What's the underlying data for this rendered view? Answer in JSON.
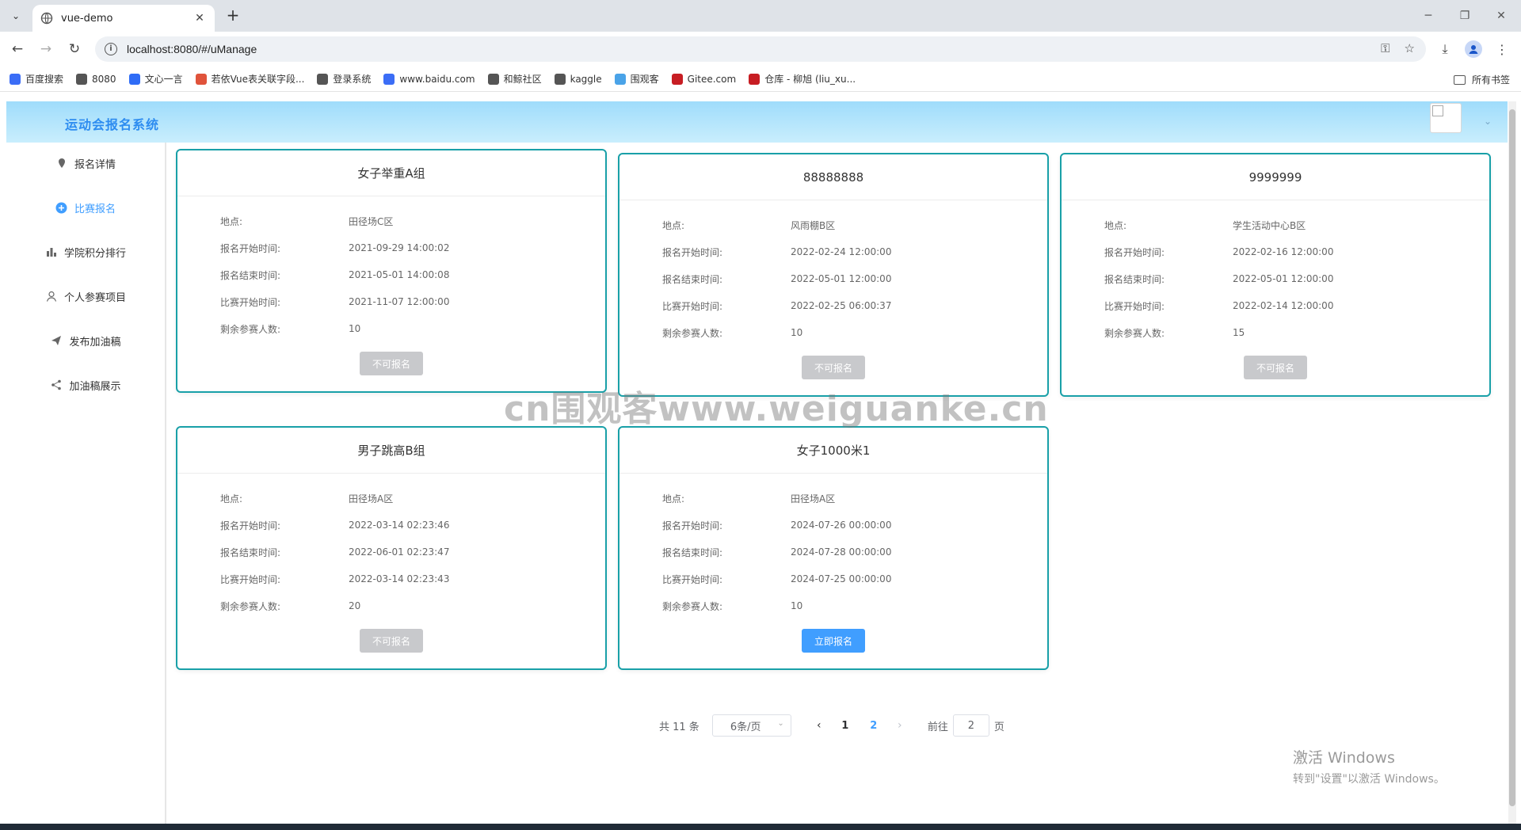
{
  "browser": {
    "tab_title": "vue-demo",
    "url": "localhost:8080/#/uManage",
    "bookmarks": [
      {
        "label": "百度搜索",
        "color": "#3b6df6"
      },
      {
        "label": "8080",
        "color": "#555555"
      },
      {
        "label": "文心一言",
        "color": "#2f6cf6"
      },
      {
        "label": "若依Vue表关联字段...",
        "color": "#e0533b"
      },
      {
        "label": "登录系统",
        "color": "#555555"
      },
      {
        "label": "www.baidu.com",
        "color": "#3b6df6"
      },
      {
        "label": "和鲸社区",
        "color": "#555555"
      },
      {
        "label": "kaggle",
        "color": "#555555"
      },
      {
        "label": "围观客",
        "color": "#4aa3e8"
      },
      {
        "label": "Gitee.com",
        "color": "#c71d23"
      },
      {
        "label": "仓库 - 柳旭 (liu_xu...",
        "color": "#c71d23"
      }
    ],
    "all_bookmarks": "所有书签"
  },
  "app": {
    "title": "运动会报名系统",
    "menu": [
      {
        "label": "报名详情",
        "icon": "location-icon"
      },
      {
        "label": "比赛报名",
        "icon": "plus-circle-icon",
        "active": true
      },
      {
        "label": "学院积分排行",
        "icon": "bar-chart-icon"
      },
      {
        "label": "个人参赛项目",
        "icon": "user-icon"
      },
      {
        "label": "发布加油稿",
        "icon": "send-icon"
      },
      {
        "label": "加油稿展示",
        "icon": "share-icon"
      }
    ],
    "field_labels": {
      "location": "地点:",
      "signup_start": "报名开始时间:",
      "signup_end": "报名结束时间:",
      "match_start": "比赛开始时间:",
      "remaining": "剩余参赛人数:"
    },
    "cards": [
      {
        "name": "女子举重A组",
        "location": "田径场C区",
        "signup_start": "2021-09-29 14:00:02",
        "signup_end": "2021-05-01 14:00:08",
        "match_start": "2021-11-07 12:00:00",
        "remaining": "10",
        "button": "不可报名",
        "enabled": false
      },
      {
        "name": "88888888",
        "location": "风雨棚B区",
        "signup_start": "2022-02-24 12:00:00",
        "signup_end": "2022-05-01 12:00:00",
        "match_start": "2022-02-25 06:00:37",
        "remaining": "10",
        "button": "不可报名",
        "enabled": false
      },
      {
        "name": "9999999",
        "location": "学生活动中心B区",
        "signup_start": "2022-02-16 12:00:00",
        "signup_end": "2022-05-01 12:00:00",
        "match_start": "2022-02-14 12:00:00",
        "remaining": "15",
        "button": "不可报名",
        "enabled": false
      },
      {
        "name": "男子跳高B组",
        "location": "田径场A区",
        "signup_start": "2022-03-14 02:23:46",
        "signup_end": "2022-06-01 02:23:47",
        "match_start": "2022-03-14 02:23:43",
        "remaining": "20",
        "button": "不可报名",
        "enabled": false
      },
      {
        "name": "女子1000米1",
        "location": "田径场A区",
        "signup_start": "2024-07-26 00:00:00",
        "signup_end": "2024-07-28 00:00:00",
        "match_start": "2024-07-25 00:00:00",
        "remaining": "10",
        "button": "立即报名",
        "enabled": true
      }
    ],
    "pagination": {
      "total": "共 11 条",
      "page_size": "6条/页",
      "pages": [
        "1",
        "2"
      ],
      "current": "2",
      "goto_label": "前往",
      "goto_value": "2",
      "goto_suffix": "页"
    }
  },
  "overlay": {
    "watermark": "cn围观客www.weiguanke.cn",
    "win_activate_title": "激活 Windows",
    "win_activate_sub": "转到\"设置\"以激活 Windows。"
  }
}
